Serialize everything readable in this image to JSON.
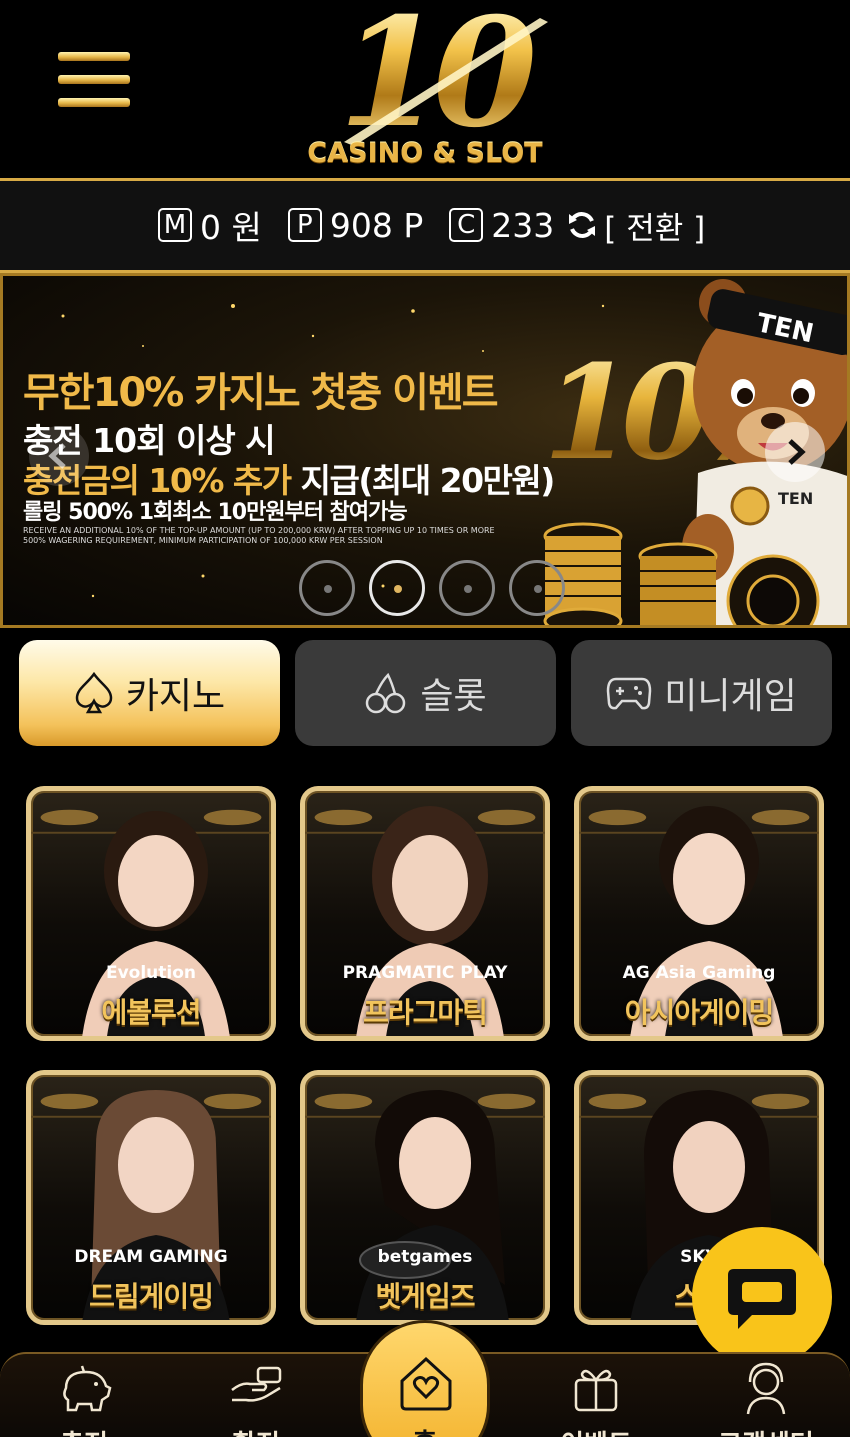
{
  "header": {
    "logo_number": "10",
    "logo_subtitle": "CASINO & SLOT",
    "menu_icon": "hamburger-menu-icon"
  },
  "balance": {
    "money_badge": "M",
    "money": "0 원",
    "point_badge": "P",
    "points": "908 P",
    "coupon_badge": "C",
    "coupons": "233",
    "switch_label": "[ 전환 ]"
  },
  "banner": {
    "title": "무한10% 카지노 첫충 이벤트",
    "line2": "충전 10회 이상 시",
    "line3_gold": "충전금의 10% 추가",
    "line3_white": " 지급(최대 20만원)",
    "line4": "롤링 500% 1회최소 10만원부터 참여가능",
    "english_1": "RECEIVE AN ADDITIONAL 10% OF THE TOP-UP AMOUNT (UP TO 200,000 KRW) AFTER TOPPING UP 10 TIMES OR MORE",
    "english_2": "500% WAGERING REQUIREMENT, MINIMUM PARTICIPATION OF 100,000 KRW PER SESSION",
    "big_number": "10%",
    "headband": "TEN",
    "shirt": "TEN",
    "slide_count": 4,
    "active_slide": 2
  },
  "tabs": [
    {
      "label": "카지노",
      "icon": "spade-icon",
      "active": true
    },
    {
      "label": "슬롯",
      "icon": "cherry-icon",
      "active": false
    },
    {
      "label": "미니게임",
      "icon": "gamepad-icon",
      "active": false
    }
  ],
  "games": [
    {
      "name": "에볼루션",
      "provider": "Evolution"
    },
    {
      "name": "프라그마틱",
      "provider": "PRAGMATIC PLAY"
    },
    {
      "name": "아시아게이밍",
      "provider": "AG Asia Gaming"
    },
    {
      "name": "드림게이밍",
      "provider": "DREAM GAMING"
    },
    {
      "name": "벳게임즈",
      "provider": "betgames"
    },
    {
      "name": "스카",
      "provider": "SKY"
    }
  ],
  "bottom_nav": [
    {
      "label": "충전",
      "icon": "piggy-bank-icon"
    },
    {
      "label": "환전",
      "icon": "money-exchange-icon"
    },
    {
      "label": "홈",
      "icon": "home-heart-icon"
    },
    {
      "label": "이벤트",
      "icon": "gift-icon"
    },
    {
      "label": "고객센터",
      "icon": "support-agent-icon"
    }
  ],
  "colors": {
    "gold": "#f0b949",
    "accent": "#f9c41a",
    "tab_inactive": "#3a3a3a",
    "background": "#000000"
  }
}
